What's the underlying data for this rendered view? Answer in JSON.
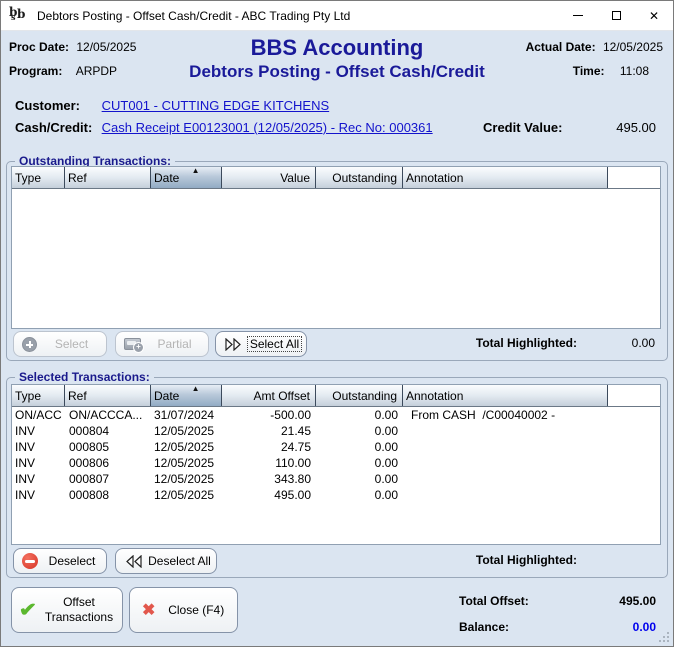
{
  "window": {
    "title": "Debtors Posting - Offset Cash/Credit - ABC Trading Pty Ltd",
    "logo_letters": {
      "b1": "b",
      "s": "s",
      "b2": "b"
    }
  },
  "icons": {
    "close_glyph": "✕",
    "sort_asc": "▲",
    "offset_check": "✔",
    "close_x": "✖"
  },
  "colors": {
    "panel_bg": "#dbe5f1",
    "title_navy": "#1a1a99",
    "link_blue": "#1313cc",
    "balance_blue": "#0000ee",
    "check_green": "#5cb82f",
    "close_red": "#e2574c",
    "deselect_red": "#d63427"
  },
  "header": {
    "proc_date_label": "Proc Date:",
    "proc_date": "12/05/2025",
    "program_label": "Program:",
    "program": "ARPDP",
    "app_title": "BBS Accounting",
    "screen_title": "Debtors Posting - Offset Cash/Credit",
    "actual_date_label": "Actual Date:",
    "actual_date": "12/05/2025",
    "time_label": "Time:",
    "time": "11:08"
  },
  "customer": {
    "label": "Customer:",
    "value": "CUT001 - CUTTING EDGE KITCHENS"
  },
  "cash_credit": {
    "label": "Cash/Credit:",
    "value": "Cash Receipt E00123001 (12/05/2025) - Rec No: 000361",
    "credit_value_label": "Credit Value:",
    "credit_value": "495.00"
  },
  "outstanding": {
    "title": "Outstanding Transactions:",
    "columns": [
      "Type",
      "Ref",
      "Date",
      "Value",
      "Outstanding",
      "Annotation"
    ],
    "sort": {
      "column": "Date",
      "direction": "ascending"
    },
    "rows": [],
    "buttons": {
      "select": {
        "label": "Select",
        "disabled": true
      },
      "partial": {
        "label": "Partial",
        "disabled": true
      },
      "select_all": {
        "label": "Select All",
        "disabled": false,
        "focused": true
      }
    },
    "total_highlighted_label": "Total Highlighted:",
    "total_highlighted": "0.00"
  },
  "selected": {
    "title": "Selected Transactions:",
    "columns": [
      "Type",
      "Ref",
      "Date",
      "Amt Offset",
      "Outstanding",
      "Annotation"
    ],
    "sort": {
      "column": "Date",
      "direction": "ascending"
    },
    "rows": [
      {
        "type": "ON/ACC",
        "ref": "ON/ACCCA...",
        "date": "31/07/2024",
        "amount": "-500.00",
        "outstanding": "0.00",
        "annotation": "From CASH  /C00040002 -"
      },
      {
        "type": "INV",
        "ref": "000804",
        "date": "12/05/2025",
        "amount": "21.45",
        "outstanding": "0.00",
        "annotation": ""
      },
      {
        "type": "INV",
        "ref": "000805",
        "date": "12/05/2025",
        "amount": "24.75",
        "outstanding": "0.00",
        "annotation": ""
      },
      {
        "type": "INV",
        "ref": "000806",
        "date": "12/05/2025",
        "amount": "110.00",
        "outstanding": "0.00",
        "annotation": ""
      },
      {
        "type": "INV",
        "ref": "000807",
        "date": "12/05/2025",
        "amount": "343.80",
        "outstanding": "0.00",
        "annotation": ""
      },
      {
        "type": "INV",
        "ref": "000808",
        "date": "12/05/2025",
        "amount": "495.00",
        "outstanding": "0.00",
        "annotation": ""
      }
    ],
    "buttons": {
      "deselect": {
        "label": "Deselect",
        "disabled": false
      },
      "deselect_all": {
        "label": "Deselect All",
        "disabled": false
      }
    },
    "total_highlighted_label": "Total Highlighted:",
    "total_highlighted": ""
  },
  "footer": {
    "offset_button_line1": "Offset",
    "offset_button_line2": "Transactions",
    "close_button": "Close (F4)",
    "total_offset_label": "Total Offset:",
    "total_offset": "495.00",
    "balance_label": "Balance:",
    "balance": "0.00"
  }
}
